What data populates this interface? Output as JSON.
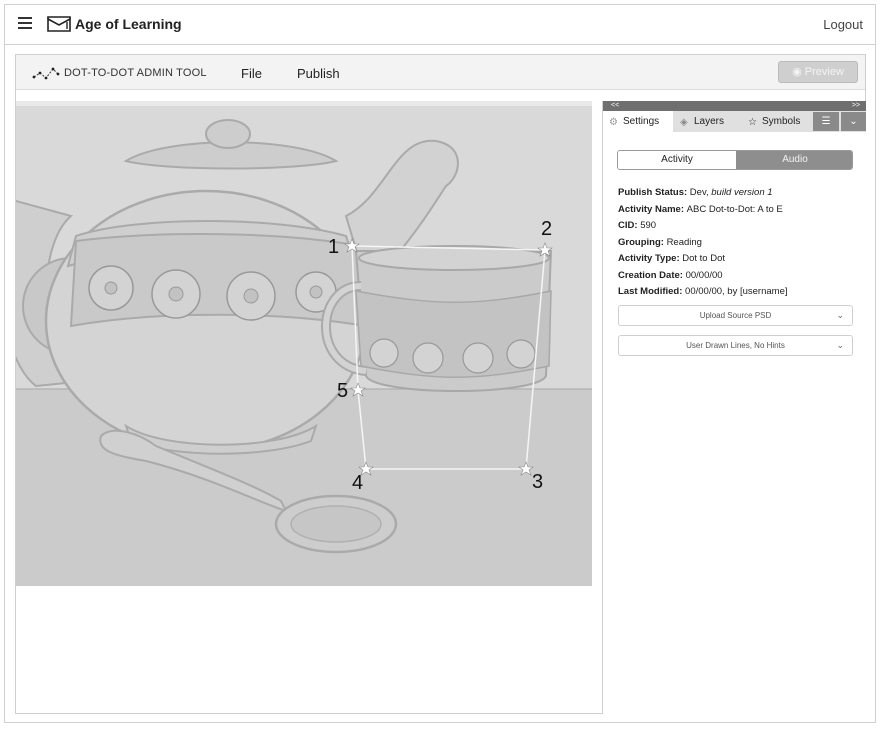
{
  "topbar": {
    "brand": "Age of Learning",
    "logout": "Logout"
  },
  "toolbar": {
    "title": "DOT-TO-DOT ADMIN TOOL",
    "menu": [
      "File",
      "Publish"
    ],
    "preview_label": "Preview"
  },
  "panel": {
    "collapse_left": "<<",
    "collapse_right": ">>",
    "tabs": [
      {
        "label": "Settings",
        "icon": "gear-icon"
      },
      {
        "label": "Layers",
        "icon": "layers-icon"
      },
      {
        "label": "Symbols",
        "icon": "star-icon"
      }
    ],
    "segment": {
      "active": "Activity",
      "inactive": "Audio"
    },
    "info": {
      "publish_status_label": "Publish Status",
      "publish_status_value": "Dev, ",
      "publish_status_build": "build version 1",
      "activity_name_label": "Activity Name",
      "activity_name_value": "ABC Dot-to-Dot: A to E",
      "cid_label": "CID",
      "cid_value": "590",
      "grouping_label": "Grouping",
      "grouping_value": "Reading",
      "activity_type_label": "Activity Type",
      "activity_type_value": "Dot to Dot",
      "creation_date_label": "Creation Date",
      "creation_date_value": "00/00/00",
      "last_modified_label": "Last Modified",
      "last_modified_value": "00/00/00, by [username]"
    },
    "upload_select": "Upload Source PSD",
    "mode_select": "User Drawn Lines, No Hints"
  },
  "canvas": {
    "dots": [
      "1",
      "2",
      "3",
      "4",
      "5"
    ]
  }
}
